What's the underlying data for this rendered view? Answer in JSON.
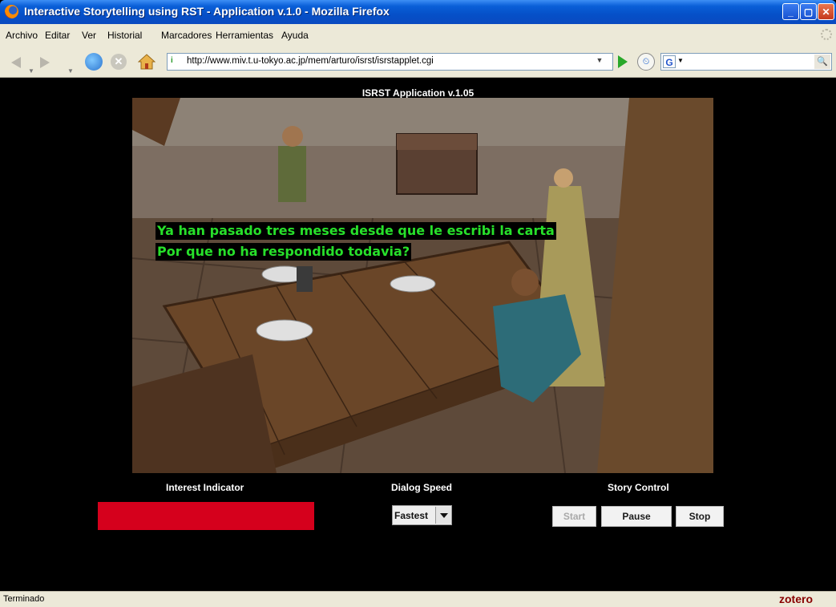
{
  "window": {
    "title": "Interactive Storytelling using RST - Application v.1.0 - Mozilla Firefox"
  },
  "menu": [
    "Archivo",
    "Editar",
    "Ver",
    "Historial",
    "Marcadores",
    "Herramientas",
    "Ayuda"
  ],
  "navbar": {
    "url": "http://www.miv.t.u-tokyo.ac.jp/mem/arturo/isrst/isrstapplet.cgi"
  },
  "app": {
    "title": "ISRST Application v.1.05",
    "dialog": [
      "Ya han pasado tres meses desde que le escribi la carta",
      "Por que no ha respondido todavia?"
    ],
    "interest_label": "Interest Indicator",
    "interest_color": "#d5001c",
    "speed_label": "Dialog Speed",
    "speed_value": "Fastest",
    "control_label": "Story Control",
    "buttons": {
      "start": "Start",
      "pause": "Pause",
      "stop": "Stop"
    }
  },
  "status": {
    "text": "Terminado",
    "zotero": "zotero"
  }
}
